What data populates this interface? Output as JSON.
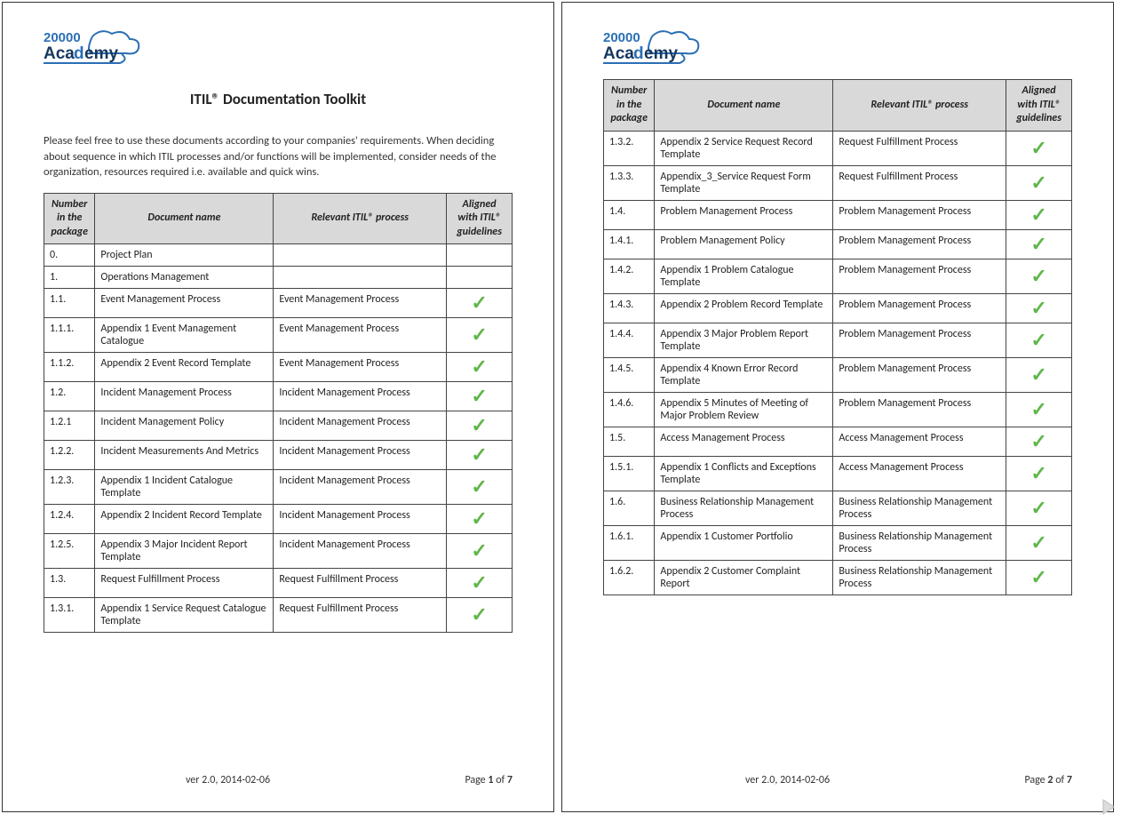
{
  "brand": {
    "top": "20000",
    "bottom": "Academy"
  },
  "title": "ITIL® Documentation Toolkit",
  "intro": "Please feel free to use these documents according to your companies' requirements. When deciding about sequence in which ITIL processes and/or functions will be implemented, consider needs of the organization, resources required i.e. available and quick wins.",
  "headers": {
    "num": "Number in the package",
    "doc": "Document name",
    "proc": "Relevant ITIL® process",
    "align": "Aligned with ITIL® guidelines"
  },
  "footer": {
    "version": "ver  2.0, 2014-02-06",
    "page_label": "Page",
    "of_label": "of",
    "total": "7"
  },
  "page1": {
    "page_no": "1",
    "rows": [
      {
        "num": "0.",
        "doc": "Project Plan",
        "proc": "",
        "check": false
      },
      {
        "num": "1.",
        "doc": "Operations Management",
        "proc": "",
        "check": false
      },
      {
        "num": "1.1.",
        "doc": "Event Management Process",
        "proc": "Event Management Process",
        "check": true
      },
      {
        "num": "1.1.1.",
        "doc": "Appendix 1 Event Management Catalogue",
        "proc": "Event Management Process",
        "check": true
      },
      {
        "num": "1.1.2.",
        "doc": "Appendix 2 Event Record Template",
        "proc": "Event Management Process",
        "check": true
      },
      {
        "num": "1.2.",
        "doc": "Incident Management Process",
        "proc": "Incident Management Process",
        "check": true
      },
      {
        "num": "1.2.1",
        "doc": "Incident Management Policy",
        "proc": "Incident Management Process",
        "check": true
      },
      {
        "num": "1.2.2.",
        "doc": "Incident Measurements And Metrics",
        "proc": "Incident Management Process",
        "check": true
      },
      {
        "num": "1.2.3.",
        "doc": "Appendix 1 Incident Catalogue Template",
        "proc": "Incident Management Process",
        "check": true
      },
      {
        "num": "1.2.4.",
        "doc": "Appendix 2 Incident Record Template",
        "proc": "Incident Management Process",
        "check": true
      },
      {
        "num": "1.2.5.",
        "doc": "Appendix 3 Major Incident Report Template",
        "proc": "Incident Management Process",
        "check": true
      },
      {
        "num": "1.3.",
        "doc": "Request Fulfillment Process",
        "proc": "Request Fulfillment Process",
        "check": true
      },
      {
        "num": "1.3.1.",
        "doc": "Appendix 1 Service Request Catalogue Template",
        "proc": "Request Fulfillment Process",
        "check": true
      }
    ]
  },
  "page2": {
    "page_no": "2",
    "rows": [
      {
        "num": "1.3.2.",
        "doc": "Appendix 2 Service Request Record Template",
        "proc": "Request Fulfillment Process",
        "check": true
      },
      {
        "num": "1.3.3.",
        "doc": "Appendix_3_Service Request Form Template",
        "proc": "Request Fulfillment Process",
        "check": true
      },
      {
        "num": "1.4.",
        "doc": "Problem Management Process",
        "proc": "Problem Management Process",
        "check": true
      },
      {
        "num": "1.4.1.",
        "doc": "Problem Management Policy",
        "proc": "Problem Management Process",
        "check": true
      },
      {
        "num": "1.4.2.",
        "doc": "Appendix 1 Problem Catalogue Template",
        "proc": "Problem Management Process",
        "check": true
      },
      {
        "num": "1.4.3.",
        "doc": "Appendix 2 Problem Record Template",
        "proc": "Problem Management Process",
        "check": true
      },
      {
        "num": "1.4.4.",
        "doc": "Appendix 3 Major Problem Report Template",
        "proc": "Problem Management Process",
        "check": true
      },
      {
        "num": "1.4.5.",
        "doc": "Appendix 4 Known Error Record Template",
        "proc": "Problem Management Process",
        "check": true
      },
      {
        "num": "1.4.6.",
        "doc": "Appendix 5 Minutes of Meeting of Major Problem Review",
        "proc": "Problem Management Process",
        "check": true
      },
      {
        "num": "1.5.",
        "doc": "Access Management Process",
        "proc": "Access Management Process",
        "check": true
      },
      {
        "num": "1.5.1.",
        "doc": "Appendix 1 Conflicts and Exceptions Template",
        "proc": "Access Management Process",
        "check": true
      },
      {
        "num": "1.6.",
        "doc": "Business Relationship Management Process",
        "proc": "Business Relationship Management Process",
        "check": true
      },
      {
        "num": "1.6.1.",
        "doc": "Appendix 1 Customer Portfolio",
        "proc": "Business Relationship Management Process",
        "check": true
      },
      {
        "num": "1.6.2.",
        "doc": "Appendix 2 Customer Complaint Report",
        "proc": "Business Relationship Management Process",
        "check": true
      }
    ]
  }
}
